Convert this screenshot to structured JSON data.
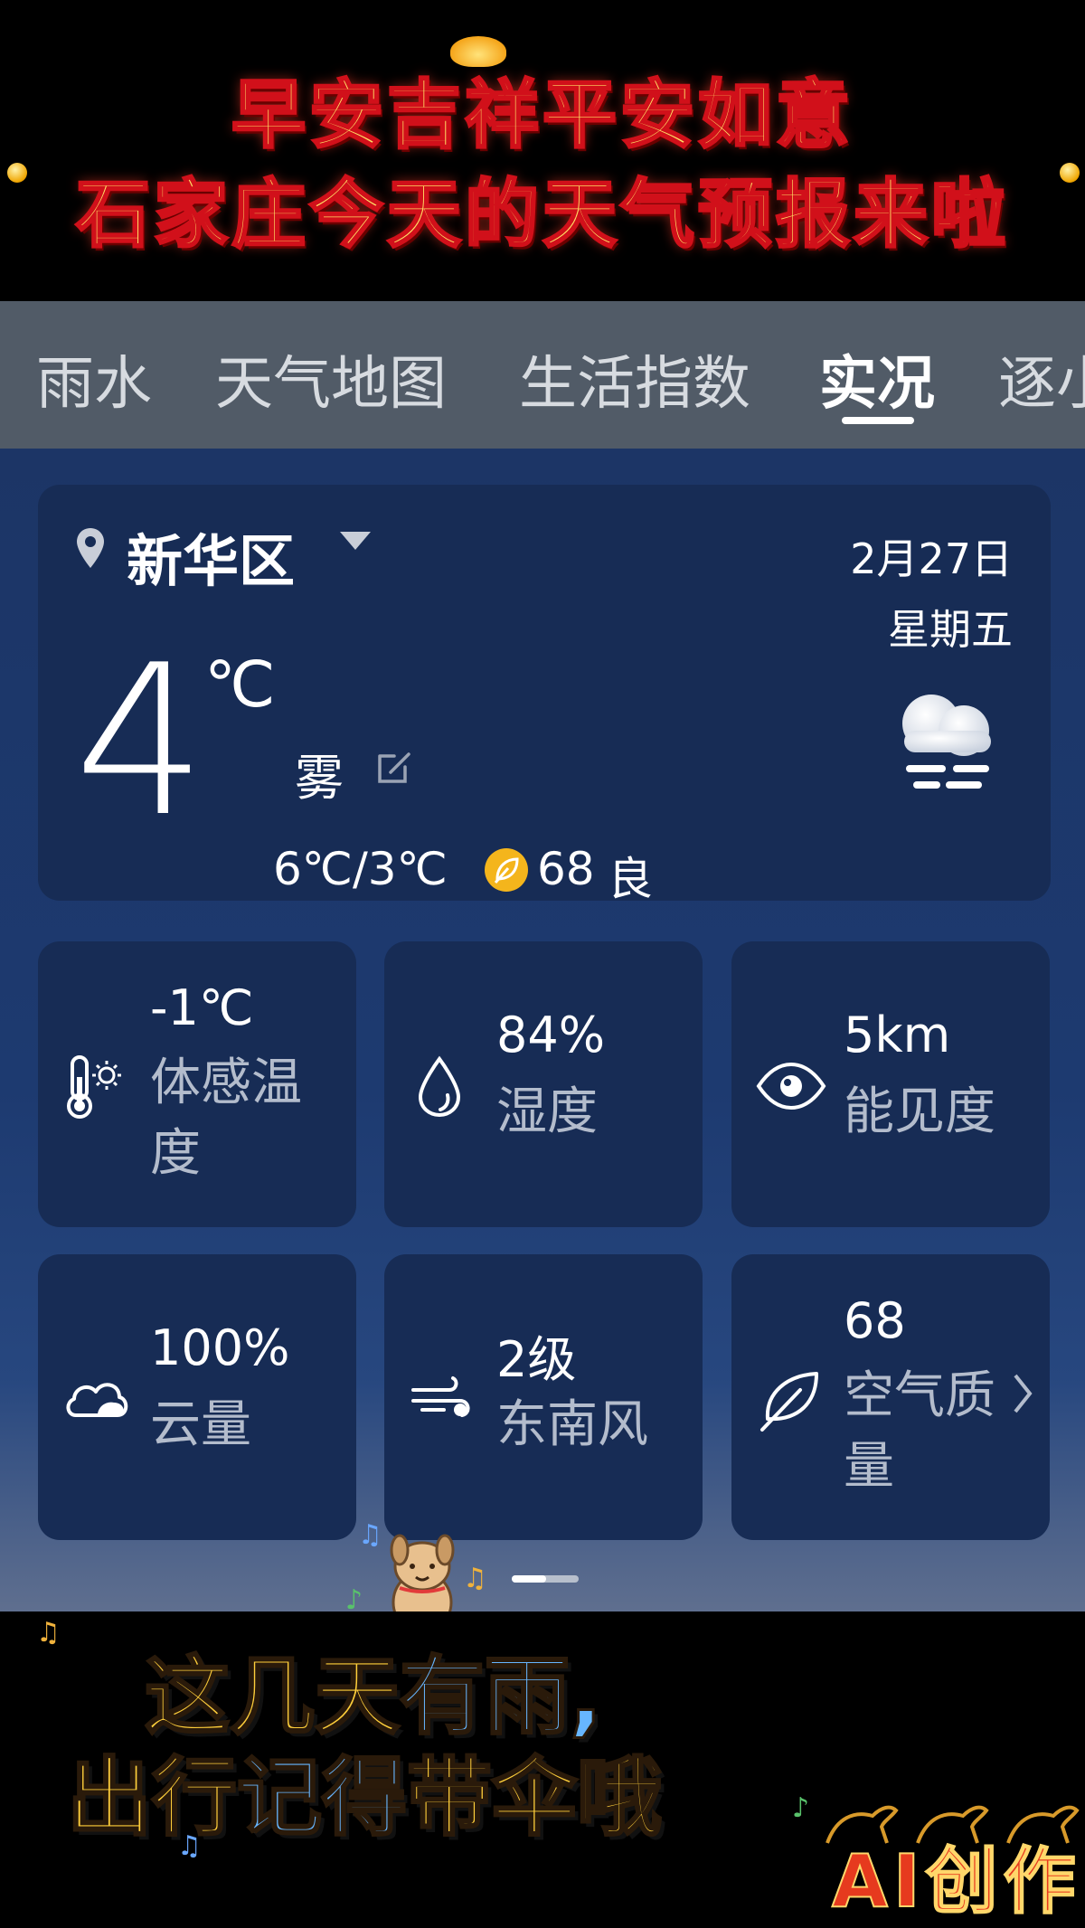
{
  "banner": {
    "line1": "早安吉祥平安如意",
    "line2": "石家庄今天的天气预报来啦"
  },
  "tabs": [
    {
      "label": "雨水",
      "active": false
    },
    {
      "label": "天气地图",
      "active": false
    },
    {
      "label": "生活指数",
      "active": false
    },
    {
      "label": "实况",
      "active": true
    },
    {
      "label": "逐小",
      "active": false
    }
  ],
  "location": {
    "name": "新华区",
    "date": "2月27日",
    "weekday": "星期五"
  },
  "current": {
    "temperature": "4",
    "unit": "℃",
    "condition": "雾",
    "range": "6℃/3℃",
    "aqi_value": "68",
    "aqi_level": "良",
    "icon": "fog-cloud-icon"
  },
  "details": [
    {
      "value": "-1℃",
      "label": "体感温度",
      "icon": "thermometer-sun-icon"
    },
    {
      "value": "84%",
      "label": "湿度",
      "icon": "water-drop-icon"
    },
    {
      "value": "5km",
      "label": "能见度",
      "icon": "eye-icon"
    },
    {
      "value": "100%",
      "label": "云量",
      "icon": "cloud-icon"
    },
    {
      "value": "2级",
      "label": "东南风",
      "icon": "wind-icon"
    },
    {
      "value": "68",
      "label": "空气质量",
      "icon": "leaf-icon"
    }
  ],
  "pager": {
    "pages": 2,
    "current": 1
  },
  "caption": {
    "line1_a": "这几天",
    "line1_b": "有雨,",
    "line2_a": "出行",
    "line2_b": "记得",
    "line2_c": "带伞哦"
  },
  "watermark": "AI创作",
  "colors": {
    "accent_gold": "#ffcf3b",
    "accent_blue": "#67b6ff",
    "banner_red": "#d1101a",
    "app_bg": "#1c3566",
    "card_bg": "#172c55",
    "aqi_yellow": "#f4b51c"
  }
}
